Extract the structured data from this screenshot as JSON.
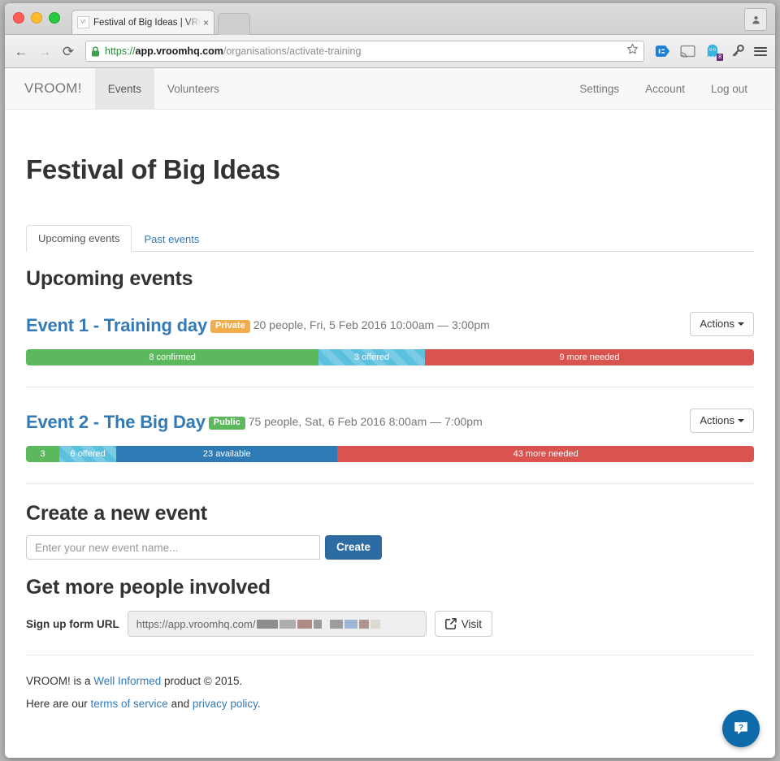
{
  "browser": {
    "tab_title": "Festival of Big Ideas | VROO",
    "tab_favicon": "V!",
    "tab_close_icon": "×",
    "back_icon": "←",
    "forward_icon": "→",
    "reload_icon": "⟳",
    "url": {
      "scheme": "https://",
      "host": "app.vroomhq.com",
      "path": "/organisations/activate-training"
    },
    "extension_badge": "8"
  },
  "navbar": {
    "brand": "VROOM!",
    "left_items": [
      {
        "label": "Events",
        "active": true
      },
      {
        "label": "Volunteers",
        "active": false
      }
    ],
    "right_items": [
      {
        "label": "Settings"
      },
      {
        "label": "Account"
      },
      {
        "label": "Log out"
      }
    ]
  },
  "page": {
    "title": "Festival of Big Ideas",
    "tabs": [
      {
        "label": "Upcoming events",
        "active": true
      },
      {
        "label": "Past events",
        "active": false
      }
    ],
    "section_heading": "Upcoming events"
  },
  "events": [
    {
      "name": "Event 1 - Training day",
      "badge": "Private",
      "badge_type": "private",
      "meta": "20 people, Fri, 5 Feb 2016 10:00am — 3:00pm",
      "actions_label": "Actions",
      "segments": [
        {
          "label": "8 confirmed",
          "style": "green",
          "percent": 40.2
        },
        {
          "label": "3 offered",
          "style": "striped",
          "percent": 14.6
        },
        {
          "label": "9 more needed",
          "style": "red",
          "percent": 45.2
        }
      ]
    },
    {
      "name": "Event 2 - The Big Day",
      "badge": "Public",
      "badge_type": "public",
      "meta": "75 people, Sat, 6 Feb 2016 8:00am — 7:00pm",
      "actions_label": "Actions",
      "segments": [
        {
          "label": "3",
          "style": "green",
          "percent": 4.6
        },
        {
          "label": "6 offered",
          "style": "striped",
          "percent": 7.8
        },
        {
          "label": "23 available",
          "style": "blue",
          "percent": 30.4
        },
        {
          "label": "43 more needed",
          "style": "red",
          "percent": 57.2
        }
      ]
    }
  ],
  "create_event": {
    "heading": "Create a new event",
    "placeholder": "Enter your new event name...",
    "value": "",
    "button": "Create"
  },
  "signup": {
    "heading": "Get more people involved",
    "label": "Sign up form URL",
    "url_prefix": "https://app.vroomhq.com/",
    "visit_label": "Visit"
  },
  "footer": {
    "line1_before": "VROOM! is a ",
    "line1_link": "Well Informed",
    "line1_after": " product © 2015.",
    "line2_before": "Here are our ",
    "line2_link1": "terms of service",
    "line2_middle": " and ",
    "line2_link2": "privacy policy",
    "line2_after": "."
  },
  "help": {
    "glyph": "?"
  },
  "colors": {
    "confirmed": "#5cb85c",
    "offered": "#5bc0de",
    "available": "#2d7ab5",
    "needed": "#d9534f",
    "link": "#337ab7",
    "primary": "#2d6ca2"
  }
}
